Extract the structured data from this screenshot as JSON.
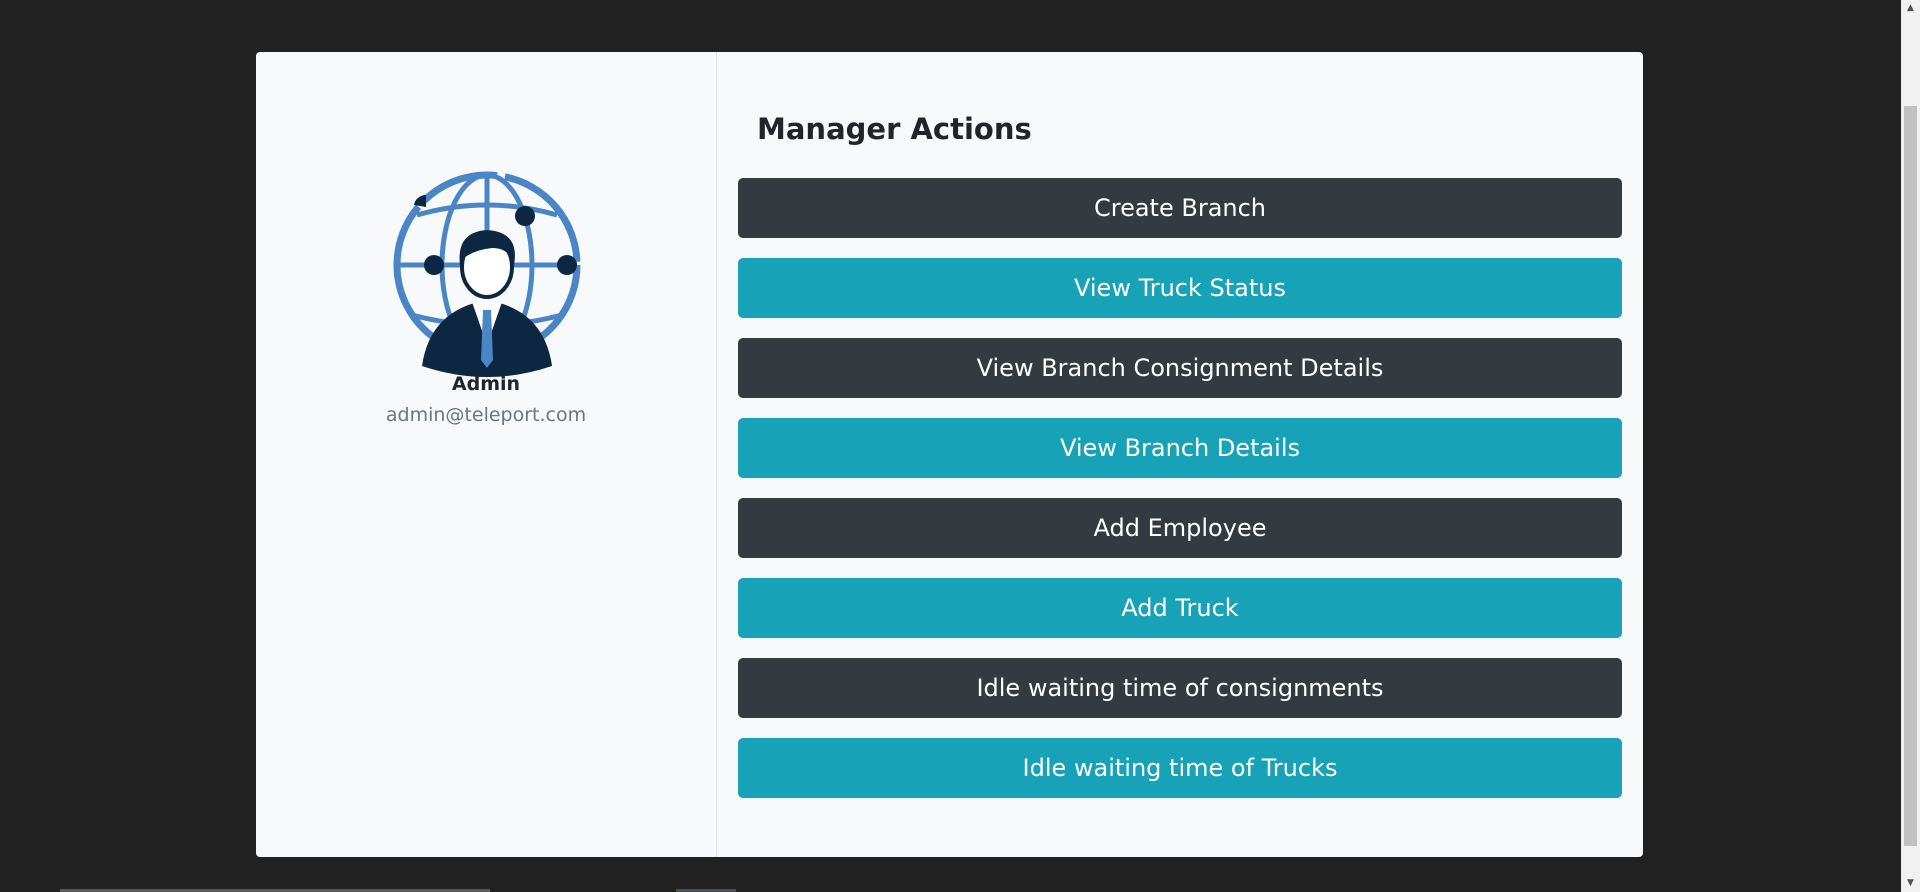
{
  "profile": {
    "name": "Admin",
    "email": "admin@teleport.com",
    "avatar_icon": "manager-globe-avatar-icon"
  },
  "actions": {
    "title": "Manager Actions",
    "buttons": [
      {
        "label": "Create Branch",
        "style": "dark"
      },
      {
        "label": "View Truck Status",
        "style": "info"
      },
      {
        "label": "View Branch Consignment Details",
        "style": "dark"
      },
      {
        "label": "View Branch Details",
        "style": "info"
      },
      {
        "label": "Add Employee",
        "style": "dark"
      },
      {
        "label": "Add Truck",
        "style": "info"
      },
      {
        "label": "Idle waiting time of consignments",
        "style": "dark"
      },
      {
        "label": "Idle waiting time of Trucks",
        "style": "info"
      }
    ]
  },
  "colors": {
    "page_background": "#212121",
    "card_background": "#f8f9fa",
    "dark_button": "#343a40",
    "info_button": "#17a2b8",
    "avatar_blue": "#4a86c5",
    "avatar_navy": "#0d2642"
  }
}
